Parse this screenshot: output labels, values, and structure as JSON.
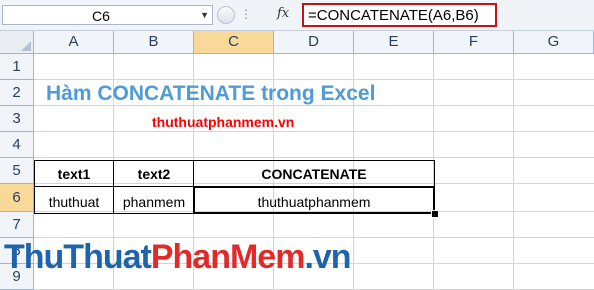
{
  "formula_bar": {
    "name_box": "C6",
    "fx_label": "fx",
    "formula": "=CONCATENATE(A6,B6)"
  },
  "columns": [
    "A",
    "B",
    "C",
    "D",
    "E",
    "F",
    "G"
  ],
  "rows": [
    "1",
    "2",
    "3",
    "4",
    "5",
    "6",
    "7",
    "8",
    "9"
  ],
  "selected_cell": {
    "column": "C",
    "row": "6"
  },
  "sheet": {
    "title": "Hàm CONCATENATE trong Excel",
    "subtitle": "thuthuatphanmem.vn",
    "table": {
      "headers": [
        "text1",
        "text2",
        "CONCATENATE"
      ],
      "row": [
        "thuthuat",
        "phanmem",
        "thuthuatphanmem"
      ]
    }
  },
  "watermark": {
    "part1": "ThuThuat",
    "part2": "PhanMem",
    "part3": ".vn"
  },
  "colors": {
    "title": "#4f9bd6",
    "subtitle": "#ff0000",
    "formula_highlight": "#c0141a",
    "selected_header": "#f9d99a",
    "watermark_blue": "#1f64a8",
    "watermark_red": "#e12b2b"
  }
}
